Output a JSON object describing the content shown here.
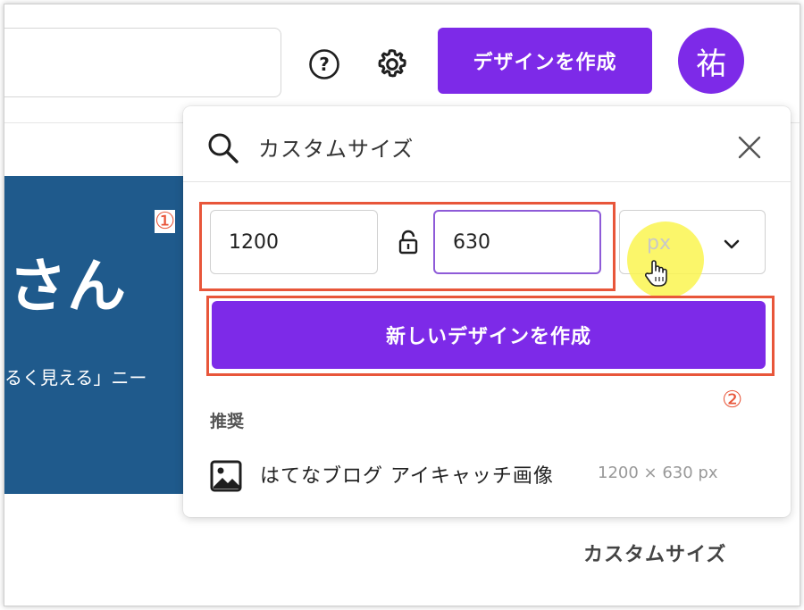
{
  "header": {
    "create_button_label": "デザインを作成",
    "avatar_initial": "祐"
  },
  "background": {
    "hero_heading": "さん",
    "hero_text": "るく見える」ニー",
    "bottom_label": "カスタムサイズ"
  },
  "panel": {
    "search_value": "カスタムサイズ",
    "width_value": "1200",
    "height_value": "630",
    "unit_selected": "px",
    "new_design_button_label": "新しいデザインを作成",
    "recommended_heading": "推奨",
    "suggestion": {
      "name": "はてなブログ アイキャッチ画像",
      "size": "1200 × 630 px"
    }
  },
  "annotations": {
    "label_1": "①",
    "label_2": "②"
  },
  "colors": {
    "accent_purple": "#7d2ae8",
    "annotation_orange": "#e8563a",
    "hero_blue": "#1f5a8c"
  },
  "icons": [
    "help-icon",
    "gear-icon",
    "search-icon",
    "close-icon",
    "lock-icon",
    "chevron-down-icon",
    "hand-cursor-icon",
    "image-icon"
  ]
}
